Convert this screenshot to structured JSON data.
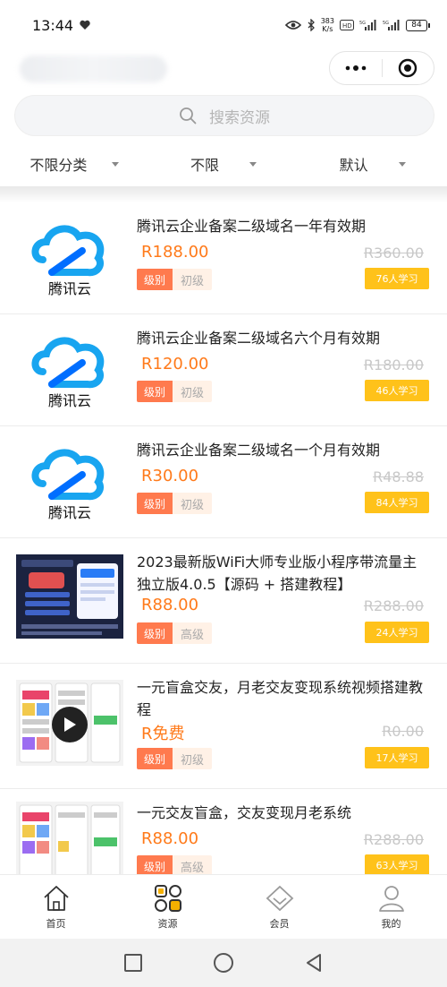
{
  "status_bar": {
    "time": "13:44",
    "net_speed_value": "383",
    "net_speed_unit": "K/s",
    "battery": "84"
  },
  "search": {
    "placeholder": "搜索资源"
  },
  "filters": [
    {
      "label": "不限分类"
    },
    {
      "label": "不限"
    },
    {
      "label": "默认"
    }
  ],
  "level_tag_label": "级别",
  "items": [
    {
      "thumbnail": "tencent-cloud-logo",
      "logo_text": "腾讯云",
      "title": "腾讯云企业备案二级域名一年有效期",
      "price": "R188.00",
      "original_price": "R360.00",
      "level": "初级",
      "learners": "76人学习"
    },
    {
      "thumbnail": "tencent-cloud-logo",
      "logo_text": "腾讯云",
      "title": "腾讯云企业备案二级域名六个月有效期",
      "price": "R120.00",
      "original_price": "R180.00",
      "level": "初级",
      "learners": "46人学习"
    },
    {
      "thumbnail": "tencent-cloud-logo",
      "logo_text": "腾讯云",
      "title": "腾讯云企业备案二级域名一个月有效期",
      "price": "R30.00",
      "original_price": "R48.88",
      "level": "初级",
      "learners": "84人学习"
    },
    {
      "thumbnail": "wifi-miniprogram-poster",
      "title": "2023最新版WiFi大师专业版小程序带流量主独立版4.0.5【源码 + 搭建教程】",
      "price": "R88.00",
      "original_price": "R288.00",
      "level": "高级",
      "learners": "24人学习"
    },
    {
      "thumbnail": "video-screenshots",
      "title": "一元盲盒交友，月老交友变现系统视频搭建教程",
      "price": "R免费",
      "original_price": "R0.00",
      "level": "初级",
      "learners": "17人学习"
    },
    {
      "thumbnail": "app-screenshots",
      "title": "一元交友盲盒，交友变现月老系统",
      "price": "R88.00",
      "original_price": "R288.00",
      "level": "高级",
      "learners": "63人学习"
    }
  ],
  "tabs": [
    {
      "label": "首页",
      "icon": "home-icon",
      "active": false
    },
    {
      "label": "资源",
      "icon": "grid-icon",
      "active": true
    },
    {
      "label": "会员",
      "icon": "diamond-icon",
      "active": false
    },
    {
      "label": "我的",
      "icon": "user-icon",
      "active": false
    }
  ],
  "colors": {
    "price": "#ff7a1a",
    "level_tag": "#ff7a4e",
    "learners_badge": "#ffc21a",
    "active_tab": "#f5b000"
  }
}
